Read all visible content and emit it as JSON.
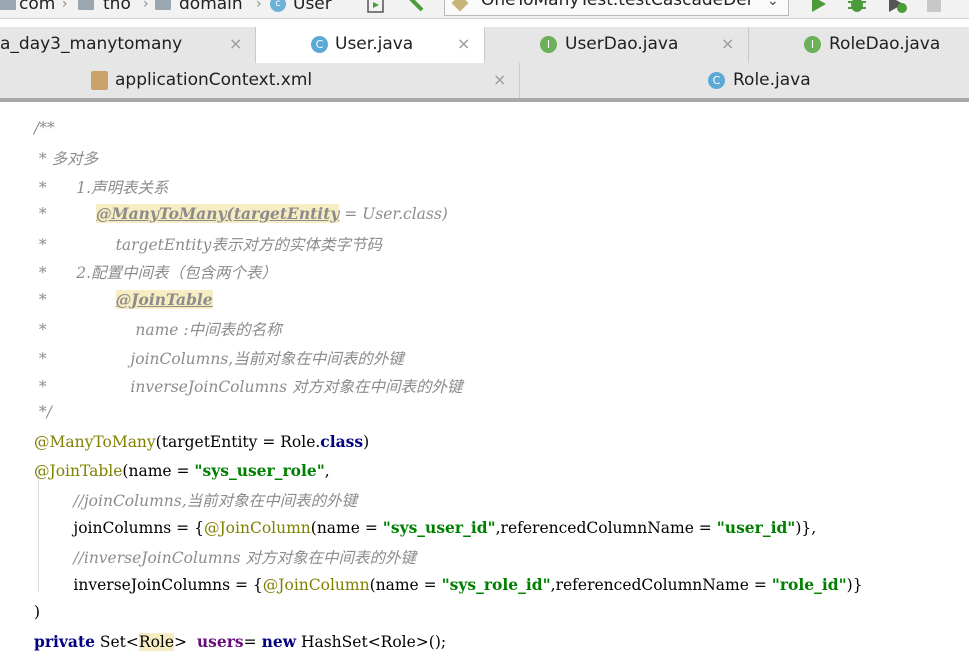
{
  "navbar": {
    "crumb_com": "com",
    "crumb_tho": "tho",
    "crumb_domain": "domain",
    "crumb_user": "User",
    "run_config": "OneToManyTest.testCascadeDel",
    "icons": [
      "folder-icon",
      "class-icon",
      "build-icon",
      "hammer-icon",
      "run-icon",
      "debug-icon",
      "coverage-icon",
      "stop-icon"
    ]
  },
  "tabs_row1": [
    {
      "label": "a_day3_manytomany",
      "icon": "",
      "active": false
    },
    {
      "label": "User.java",
      "icon": "C",
      "active": true
    },
    {
      "label": "UserDao.java",
      "icon": "I",
      "active": false
    },
    {
      "label": "RoleDao.java",
      "icon": "I",
      "active": false
    }
  ],
  "tabs_row2": [
    {
      "label": "applicationContext.xml",
      "icon": "xml"
    },
    {
      "label": "Role.java",
      "icon": "C"
    }
  ],
  "close_glyph": "×",
  "code": {
    "l1": "/**",
    "l2": " * 多对多",
    "l3": " *      1.声明表关系",
    "l4a": " *          ",
    "l4b": "@ManyToMany(targetEntity",
    "l4c": " = User.class)",
    "l5": " *              targetEntity表示对方的实体类字节码",
    "l6": " *      2.配置中间表（包含两个表）",
    "l7a": " *              ",
    "l7b": "@JoinTable",
    "l8": " *                  name :中间表的名称",
    "l9": " *                 joinColumns,当前对象在中间表的外键",
    "l10": " *                 inverseJoinColumns 对方对象在中间表的外键",
    "l11": " */",
    "l12a": "@ManyToMany",
    "l12b": "(targetEntity = Role.",
    "l12c": "class",
    "l12d": ")",
    "l13a": "@JoinTable",
    "l13b": "(name = ",
    "l13c": "\"sys_user_role\"",
    "l13d": ",",
    "l14": "        //joinColumns,当前对象在中间表的外键",
    "l15a": "        joinColumns = {",
    "l15b": "@JoinColumn",
    "l15c": "(name = ",
    "l15d": "\"sys_user_id\"",
    "l15e": ",referencedColumnName = ",
    "l15f": "\"user_id\"",
    "l15g": ")},",
    "l16": "        //inverseJoinColumns 对方对象在中间表的外键",
    "l17a": "        inverseJoinColumns = {",
    "l17b": "@JoinColumn",
    "l17c": "(name = ",
    "l17d": "\"sys_role_id\"",
    "l17e": ",referencedColumnName = ",
    "l17f": "\"role_id\"",
    "l17g": ")}",
    "l18": ")",
    "l19a": "private",
    "l19b": " Set<",
    "l19c": "Role",
    "l19d": ">  ",
    "l19e": "users",
    "l19f": "= ",
    "l19g": "new",
    "l19h": " HashSet<Role>();"
  }
}
